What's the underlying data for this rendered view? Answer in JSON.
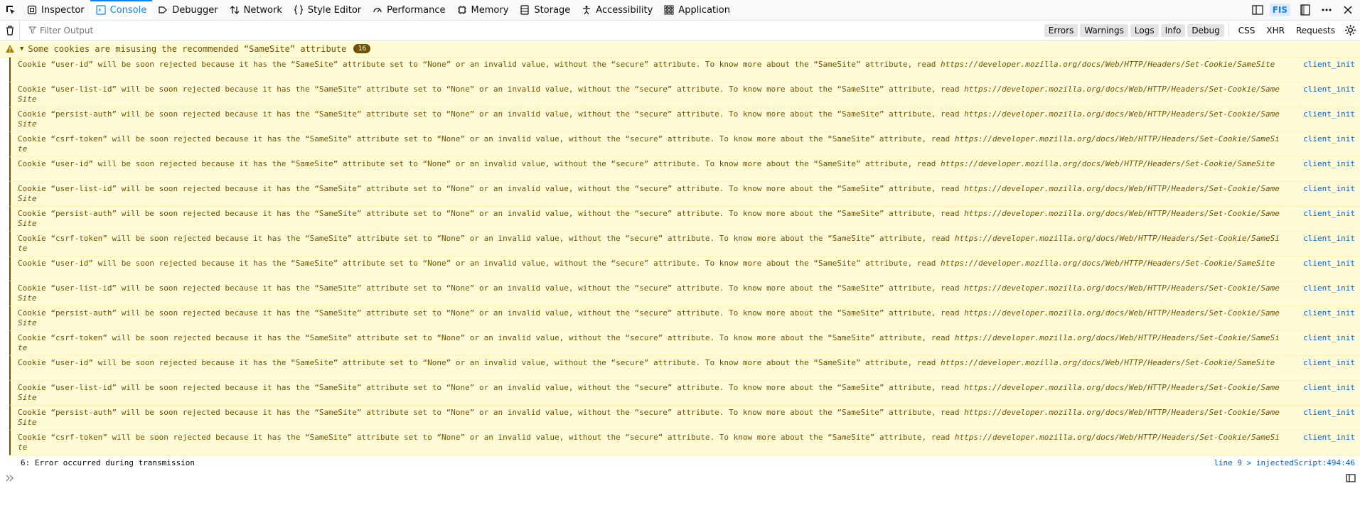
{
  "toolbar": {
    "tabs": [
      {
        "label": "Inspector",
        "icon": "inspector-icon"
      },
      {
        "label": "Console",
        "icon": "console-icon"
      },
      {
        "label": "Debugger",
        "icon": "debugger-icon"
      },
      {
        "label": "Network",
        "icon": "network-icon"
      },
      {
        "label": "Style Editor",
        "icon": "style-editor-icon"
      },
      {
        "label": "Performance",
        "icon": "performance-icon"
      },
      {
        "label": "Memory",
        "icon": "memory-icon"
      },
      {
        "label": "Storage",
        "icon": "storage-icon"
      },
      {
        "label": "Accessibility",
        "icon": "accessibility-icon"
      },
      {
        "label": "Application",
        "icon": "application-icon"
      }
    ],
    "active_tab": "Console",
    "fis_label": "FIS"
  },
  "filterbar": {
    "placeholder": "Filter Output",
    "levels": [
      "Errors",
      "Warnings",
      "Logs",
      "Info",
      "Debug"
    ],
    "kinds": [
      "CSS",
      "XHR",
      "Requests"
    ]
  },
  "group": {
    "title": "Some cookies are misusing the recommended “SameSite” attribute",
    "count": "16"
  },
  "messages": [
    {
      "text": "Cookie “user-id” will be soon rejected because it has the “SameSite” attribute set to “None” or an invalid value, without the “secure” attribute. To know more about the “SameSite” attribute, read ",
      "link": "https://developer.mozilla.org/docs/Web/HTTP/Headers/Set-Cookie/SameSite",
      "source": "client_init"
    },
    {
      "text": "Cookie “user-list-id” will be soon rejected because it has the “SameSite” attribute set to “None” or an invalid value, without the “secure” attribute. To know more about the “SameSite” attribute, read ",
      "link": "https://developer.mozilla.org/docs/Web/HTTP/Headers/Set-Cookie/SameSite",
      "source": "client_init"
    },
    {
      "text": "Cookie “persist-auth” will be soon rejected because it has the “SameSite” attribute set to “None” or an invalid value, without the “secure” attribute. To know more about the “SameSite” attribute, read ",
      "link": "https://developer.mozilla.org/docs/Web/HTTP/Headers/Set-Cookie/SameSite",
      "source": "client_init"
    },
    {
      "text": "Cookie “csrf-token” will be soon rejected because it has the “SameSite” attribute set to “None” or an invalid value, without the “secure” attribute. To know more about the “SameSite” attribute, read ",
      "link": "https://developer.mozilla.org/docs/Web/HTTP/Headers/Set-Cookie/SameSite",
      "source": "client_init"
    },
    {
      "text": "Cookie “user-id” will be soon rejected because it has the “SameSite” attribute set to “None” or an invalid value, without the “secure” attribute. To know more about the “SameSite” attribute, read ",
      "link": "https://developer.mozilla.org/docs/Web/HTTP/Headers/Set-Cookie/SameSite",
      "source": "client_init"
    },
    {
      "text": "Cookie “user-list-id” will be soon rejected because it has the “SameSite” attribute set to “None” or an invalid value, without the “secure” attribute. To know more about the “SameSite” attribute, read ",
      "link": "https://developer.mozilla.org/docs/Web/HTTP/Headers/Set-Cookie/SameSite",
      "source": "client_init"
    },
    {
      "text": "Cookie “persist-auth” will be soon rejected because it has the “SameSite” attribute set to “None” or an invalid value, without the “secure” attribute. To know more about the “SameSite” attribute, read ",
      "link": "https://developer.mozilla.org/docs/Web/HTTP/Headers/Set-Cookie/SameSite",
      "source": "client_init"
    },
    {
      "text": "Cookie “csrf-token” will be soon rejected because it has the “SameSite” attribute set to “None” or an invalid value, without the “secure” attribute. To know more about the “SameSite” attribute, read ",
      "link": "https://developer.mozilla.org/docs/Web/HTTP/Headers/Set-Cookie/SameSite",
      "source": "client_init"
    },
    {
      "text": "Cookie “user-id” will be soon rejected because it has the “SameSite” attribute set to “None” or an invalid value, without the “secure” attribute. To know more about the “SameSite” attribute, read ",
      "link": "https://developer.mozilla.org/docs/Web/HTTP/Headers/Set-Cookie/SameSite",
      "source": "client_init"
    },
    {
      "text": "Cookie “user-list-id” will be soon rejected because it has the “SameSite” attribute set to “None” or an invalid value, without the “secure” attribute. To know more about the “SameSite” attribute, read ",
      "link": "https://developer.mozilla.org/docs/Web/HTTP/Headers/Set-Cookie/SameSite",
      "source": "client_init"
    },
    {
      "text": "Cookie “persist-auth” will be soon rejected because it has the “SameSite” attribute set to “None” or an invalid value, without the “secure” attribute. To know more about the “SameSite” attribute, read ",
      "link": "https://developer.mozilla.org/docs/Web/HTTP/Headers/Set-Cookie/SameSite",
      "source": "client_init"
    },
    {
      "text": "Cookie “csrf-token” will be soon rejected because it has the “SameSite” attribute set to “None” or an invalid value, without the “secure” attribute. To know more about the “SameSite” attribute, read ",
      "link": "https://developer.mozilla.org/docs/Web/HTTP/Headers/Set-Cookie/SameSite",
      "source": "client_init"
    },
    {
      "text": "Cookie “user-id” will be soon rejected because it has the “SameSite” attribute set to “None” or an invalid value, without the “secure” attribute. To know more about the “SameSite” attribute, read ",
      "link": "https://developer.mozilla.org/docs/Web/HTTP/Headers/Set-Cookie/SameSite",
      "source": "client_init"
    },
    {
      "text": "Cookie “user-list-id” will be soon rejected because it has the “SameSite” attribute set to “None” or an invalid value, without the “secure” attribute. To know more about the “SameSite” attribute, read ",
      "link": "https://developer.mozilla.org/docs/Web/HTTP/Headers/Set-Cookie/SameSite",
      "source": "client_init"
    },
    {
      "text": "Cookie “persist-auth” will be soon rejected because it has the “SameSite” attribute set to “None” or an invalid value, without the “secure” attribute. To know more about the “SameSite” attribute, read ",
      "link": "https://developer.mozilla.org/docs/Web/HTTP/Headers/Set-Cookie/SameSite",
      "source": "client_init"
    },
    {
      "text": "Cookie “csrf-token” will be soon rejected because it has the “SameSite” attribute set to “None” or an invalid value, without the “secure” attribute. To know more about the “SameSite” attribute, read ",
      "link": "https://developer.mozilla.org/docs/Web/HTTP/Headers/Set-Cookie/SameSite",
      "source": "client_init"
    }
  ],
  "log": {
    "text": "6: Error occurred during transmission",
    "source": "line 9 > injectedScript:494:46"
  }
}
